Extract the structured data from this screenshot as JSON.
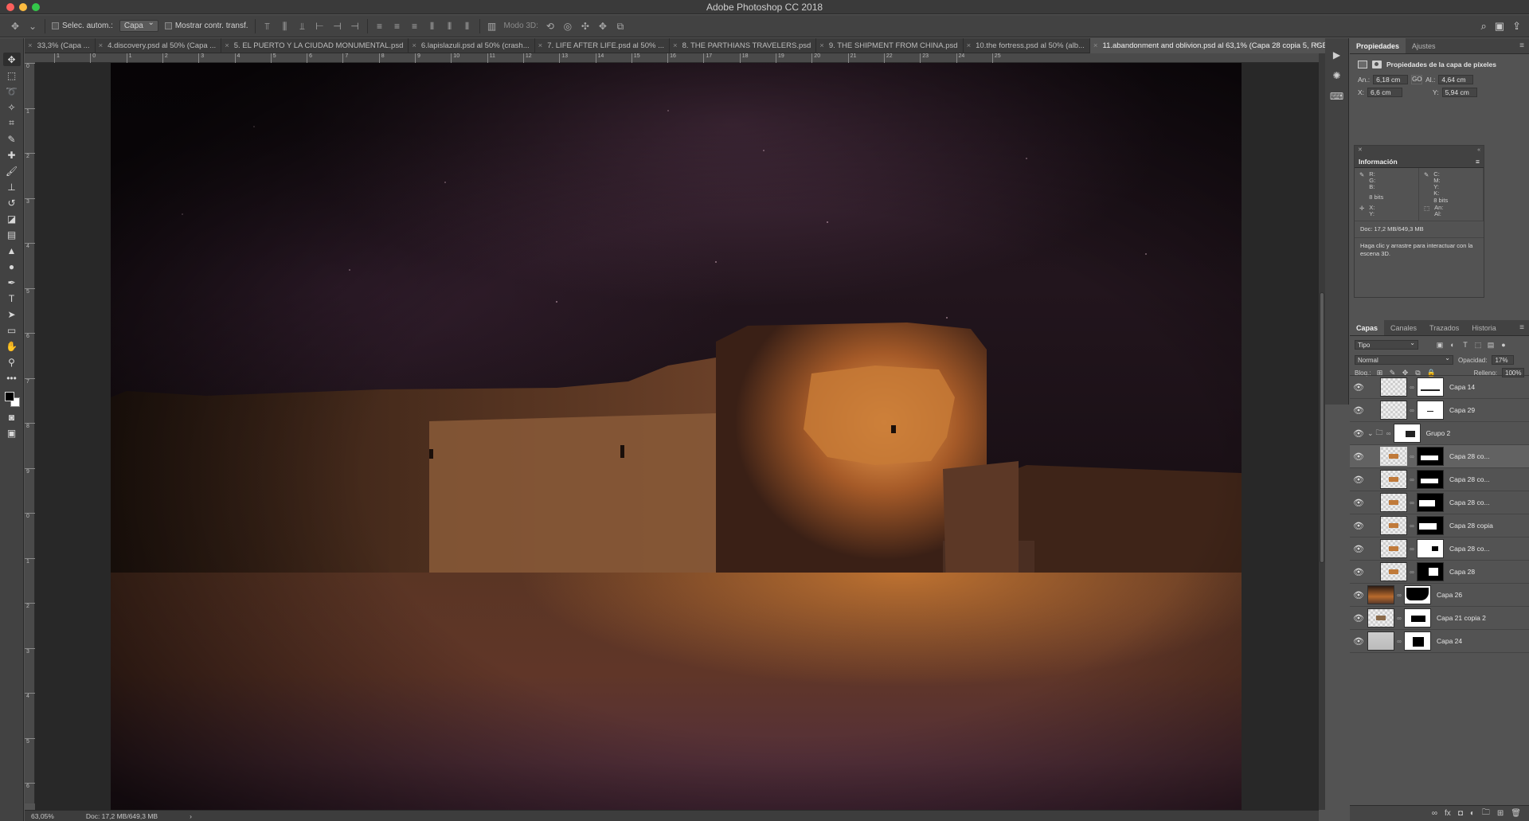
{
  "app": {
    "title": "Adobe Photoshop CC 2018"
  },
  "options_bar": {
    "auto_select_label": "Selec. autom.:",
    "auto_select_value": "Capa",
    "show_transform_label": "Mostrar contr. transf.",
    "mode3d_label": "Modo 3D:"
  },
  "tabs": [
    {
      "label": "33,3% (Capa ..."
    },
    {
      "label": "4.discovery.psd al 50% (Capa ..."
    },
    {
      "label": "5. EL PUERTO Y LA CIUDAD MONUMENTAL.psd"
    },
    {
      "label": "6.lapislazuli.psd al 50% (crash..."
    },
    {
      "label": "7. LIFE AFTER LIFE.psd al 50% ..."
    },
    {
      "label": "8. THE PARTHIANS TRAVELERS.psd"
    },
    {
      "label": "9. THE SHIPMENT FROM CHINA.psd"
    },
    {
      "label": "10.the fortress.psd al 50% (alb..."
    },
    {
      "label": "11.abandonment and oblivion.psd al 63,1% (Capa 28 copia 5, RGB/8*)"
    }
  ],
  "ruler_h": [
    "1",
    "0",
    "1",
    "2",
    "3",
    "4",
    "5",
    "6",
    "7",
    "8",
    "9",
    "10",
    "11",
    "12",
    "13",
    "14",
    "15",
    "16",
    "17",
    "18",
    "19",
    "20",
    "21",
    "22",
    "23",
    "24",
    "25"
  ],
  "ruler_v": [
    "0",
    "1",
    "2",
    "3",
    "4",
    "5",
    "6",
    "7",
    "8",
    "9",
    "0",
    "1",
    "2",
    "3",
    "4",
    "5",
    "6"
  ],
  "status": {
    "zoom": "63,05%",
    "doc": "Doc: 17,2 MB/649,3 MB"
  },
  "properties": {
    "tabs": [
      "Propiedades",
      "Ajustes"
    ],
    "title": "Propiedades de la capa de píxeles",
    "w_label": "An.:",
    "w_value": "6,18 cm",
    "h_label": "Al.:",
    "h_value": "4,64 cm",
    "x_label": "X:",
    "x_value": "6,6 cm",
    "y_label": "Y:",
    "y_value": "5,94 cm",
    "link_label": "GO"
  },
  "info": {
    "title": "Información",
    "rgb_letters": "R:\nG:\nB:",
    "cmyk_letters": "C:\nM:\nY:\nK:",
    "bits_left": "8 bits",
    "bits_right": "8 bits",
    "xy_letters": "X:\nY:",
    "wh_letters": "An:\nAl:",
    "doc": "Doc: 17,2 MB/649,3 MB",
    "hint": "Haga clic y arrastre para interactuar con la escena 3D."
  },
  "layers_panel": {
    "tabs": [
      "Capas",
      "Canales",
      "Trazados",
      "Historia"
    ],
    "kind": "Tipo",
    "blend_mode": "Normal",
    "opacity_label": "Opacidad:",
    "opacity_value": "17%",
    "lock_label": "Bloq.:",
    "fill_label": "Relleno:",
    "fill_value": "100%",
    "layers": [
      {
        "name": "Capa 14"
      },
      {
        "name": "Capa 29"
      },
      {
        "name": "Grupo 2"
      },
      {
        "name": "Capa 28 co..."
      },
      {
        "name": "Capa 28 co..."
      },
      {
        "name": "Capa 28 co..."
      },
      {
        "name": "Capa 28 copia"
      },
      {
        "name": "Capa 28 co..."
      },
      {
        "name": "Capa 28"
      },
      {
        "name": "Capa 26"
      },
      {
        "name": "Capa 21 copia 2"
      },
      {
        "name": "Capa 24"
      }
    ]
  }
}
